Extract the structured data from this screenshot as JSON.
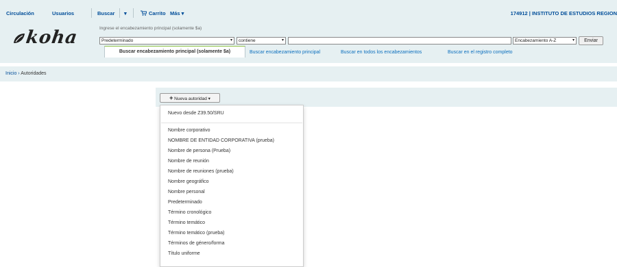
{
  "topnav": {
    "links": [
      "Circulación",
      "Usuarios",
      "Buscar",
      "▾",
      "Carrito",
      "Más ▾"
    ],
    "cart_icon": "cart-icon",
    "user_info": "174912 | INSTITUTO DE ESTUDIOS REGION"
  },
  "logo": {
    "text": "koha"
  },
  "search": {
    "hint": "Ingrese el encabezamiento principal (solamente $a)",
    "type_select": "Predeterminado",
    "operator_select": "contiene",
    "query_value": "",
    "sort_select": "Encabezamiento A-Z",
    "submit_label": "Enviar"
  },
  "tabs": {
    "active": "Buscar encabezamiento principal (solamente $a)",
    "others": [
      "Buscar encabezamiento principal",
      "Buscar en todos los encabezamientos",
      "Buscar en el registro completo"
    ]
  },
  "breadcrumb": {
    "home": "Inicio",
    "separator": "›",
    "current": "Autoridades"
  },
  "toolbar": {
    "new_button_label": "Nueva autoridad",
    "plus_icon": "plus-icon",
    "caret": "▾"
  },
  "dropdown": {
    "first_item": "Nuevo desde Z39.50/SRU",
    "items": [
      "Nombre corporativo",
      "NOMBRE DE ENTIDAD CORPORATIVA (prueba)",
      "Nombre de persona (Prueba)",
      "Nombre de reunión",
      "Nombre de reuniones (prueba)",
      "Nombre geográfico",
      "Nombre personal",
      "Predeterminado",
      "Término cronológico",
      "Término temático",
      "Término temático (prueba)",
      "Términos de género/forma",
      "Título uniforme"
    ]
  },
  "colors": {
    "nav_bg": "#e6f0f2",
    "link": "#004d99",
    "tab_link": "#0a6ebd",
    "active_tab_border": "#8fc245"
  }
}
